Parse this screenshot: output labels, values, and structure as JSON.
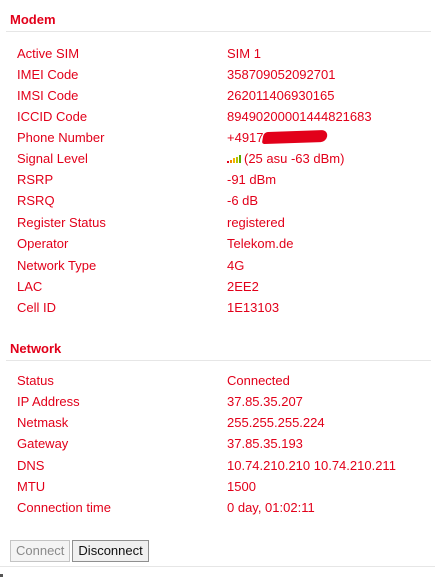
{
  "modem": {
    "title": "Modem",
    "rows": [
      {
        "label": "Active SIM",
        "value": "SIM 1"
      },
      {
        "label": "IMEI Code",
        "value": "358709052092701"
      },
      {
        "label": "IMSI Code",
        "value": "262011406930165"
      },
      {
        "label": "ICCID Code",
        "value": "89490200001444821683"
      },
      {
        "label": "Phone Number",
        "value": "+4917"
      },
      {
        "label": "Signal Level",
        "value": "(25 asu -63 dBm)"
      },
      {
        "label": "RSRP",
        "value": "-91 dBm"
      },
      {
        "label": "RSRQ",
        "value": "-6 dB"
      },
      {
        "label": "Register Status",
        "value": "registered"
      },
      {
        "label": "Operator",
        "value": "Telekom.de"
      },
      {
        "label": "Network Type",
        "value": "4G"
      },
      {
        "label": "LAC",
        "value": "2EE2"
      },
      {
        "label": "Cell ID",
        "value": "1E13103"
      }
    ],
    "signal_icon": {
      "name": "signal-strength-icon",
      "bars_total": 5,
      "bars_lit": 5,
      "bar_colors": [
        "#e2001a",
        "#f08a00",
        "#f0b400",
        "#b7c400",
        "#5aa800"
      ]
    },
    "phone_redaction_color": "#e2001a"
  },
  "network": {
    "title": "Network",
    "rows": [
      {
        "label": "Status",
        "value": "Connected"
      },
      {
        "label": "IP Address",
        "value": "37.85.35.207"
      },
      {
        "label": "Netmask",
        "value": "255.255.255.224"
      },
      {
        "label": "Gateway",
        "value": "37.85.35.193"
      },
      {
        "label": "DNS",
        "value": "10.74.210.210 10.74.210.211"
      },
      {
        "label": "MTU",
        "value": "1500"
      },
      {
        "label": "Connection time",
        "value": "0 day, 01:02:11"
      }
    ]
  },
  "actions": {
    "connect_label": "Connect",
    "connect_enabled": false,
    "disconnect_label": "Disconnect",
    "disconnect_enabled": true
  },
  "colors": {
    "accent": "#e2001a",
    "divider": "#e6e6e6"
  }
}
